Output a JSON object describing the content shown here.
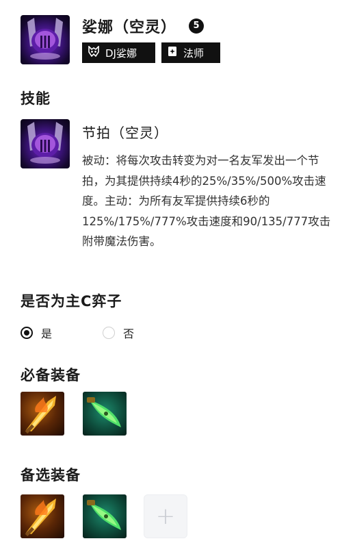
{
  "champion": {
    "name": "娑娜（空灵）",
    "cost": "5",
    "traits": [
      {
        "label": "DJ娑娜",
        "icon": "dj-mask-icon"
      },
      {
        "label": "法师",
        "icon": "spellbook-icon"
      }
    ]
  },
  "skill_section": {
    "title": "技能",
    "skill_name": "节拍（空灵）",
    "description": "被动：将每次攻击转变为对一名友军发出一个节拍，为其提供持续4秒的25%/35%/500%攻击速度。主动：为所有友军提供持续6秒的125%/175%/777%攻击速度和90/135/777攻击附带魔法伤害。"
  },
  "carry_section": {
    "title": "是否为主C弈子",
    "options": [
      {
        "label": "是",
        "selected": true
      },
      {
        "label": "否",
        "selected": false
      }
    ]
  },
  "required_items": {
    "title": "必备装备",
    "items": [
      "flaming-sword-icon",
      "green-blade-icon"
    ]
  },
  "alternate_items": {
    "title": "备选装备",
    "items": [
      "flaming-sword-icon",
      "green-blade-icon"
    ],
    "add_symbol": "+"
  },
  "colors": {
    "badge_bg": "#111111",
    "text": "#1a1a1a",
    "skill_text": "#333333",
    "add_slot_bg": "#f4f5f7"
  }
}
